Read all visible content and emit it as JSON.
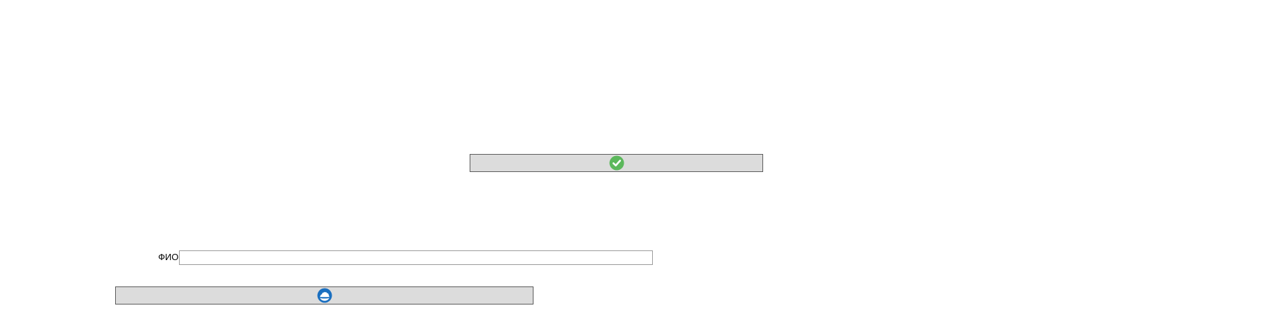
{
  "confirm_button": {
    "icon": "check-circle-icon",
    "icon_color": "#5cb85c",
    "label": ""
  },
  "form": {
    "full_name": {
      "label": "ФИО",
      "value": "",
      "placeholder": ""
    }
  },
  "secondary_button": {
    "icon": "blue-circle-emblem-icon",
    "icon_color": "#1a6fc0",
    "label": ""
  },
  "colors": {
    "button_background": "#dcdcdc",
    "button_border": "#5a5a5a",
    "input_border": "#9a9a9a",
    "page_background": "#ffffff"
  }
}
